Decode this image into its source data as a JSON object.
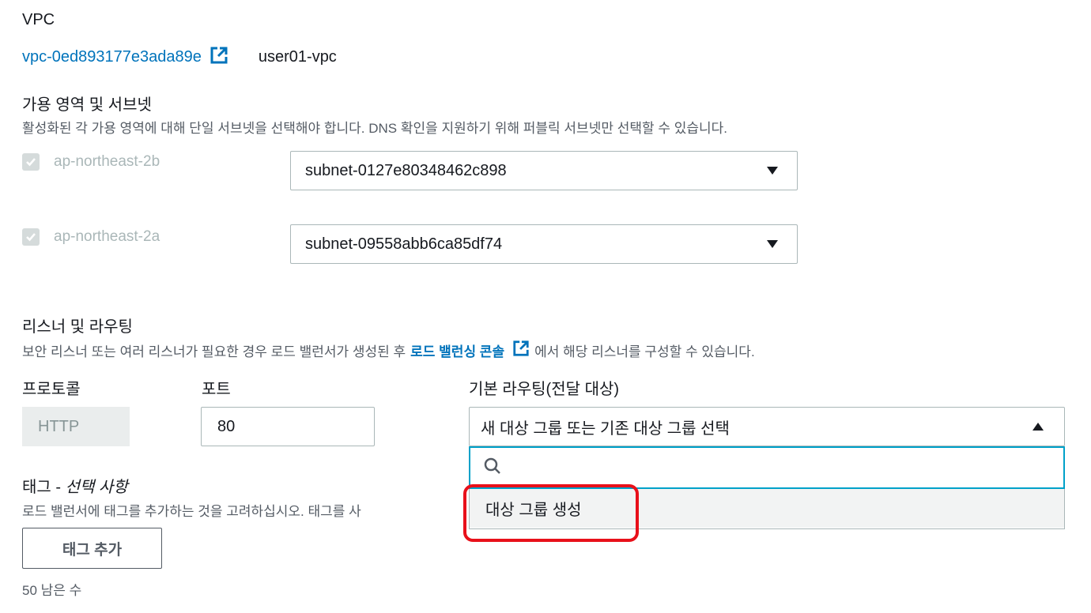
{
  "vpc": {
    "label": "VPC",
    "id_link": "vpc-0ed893177e3ada89e",
    "name": "user01-vpc"
  },
  "availability": {
    "title": "가용 영역 및 서브넷",
    "description": "활성화된 각 가용 영역에 대해 단일 서브넷을 선택해야 합니다. DNS 확인을 지원하기 위해 퍼블릭 서브넷만 선택할 수 있습니다.",
    "zones": [
      {
        "name": "ap-northeast-2b",
        "subnet": "subnet-0127e80348462c898"
      },
      {
        "name": "ap-northeast-2a",
        "subnet": "subnet-09558abb6ca85df74"
      }
    ]
  },
  "listener": {
    "title": "리스너 및 라우팅",
    "desc_before": "보안 리스너 또는 여러 리스너가 필요한 경우 로드 밸런서가 생성된 후",
    "desc_link": "로드 밸런싱 콘솔",
    "desc_after": "에서 해당 리스너를 구성할 수 있습니다.",
    "protocol_label": "프로토콜",
    "port_label": "포트",
    "routing_label": "기본 라우팅(전달 대상)",
    "protocol_value": "HTTP",
    "port_value": "80",
    "routing_placeholder": "새 대상 그룹 또는 기존 대상 그룹 선택",
    "dropdown_option": "대상 그룹 생성"
  },
  "tags": {
    "title_prefix": "태그 - ",
    "title_optional": "선택 사항",
    "description": "로드 밸런서에 태그를 추가하는 것을 고려하십시오. 태그를 사",
    "add_button": "태그 추가",
    "remaining": "50 남은 수"
  },
  "colors": {
    "link": "#0073bb",
    "focus": "#00a1c9",
    "highlight": "#e8101a"
  }
}
